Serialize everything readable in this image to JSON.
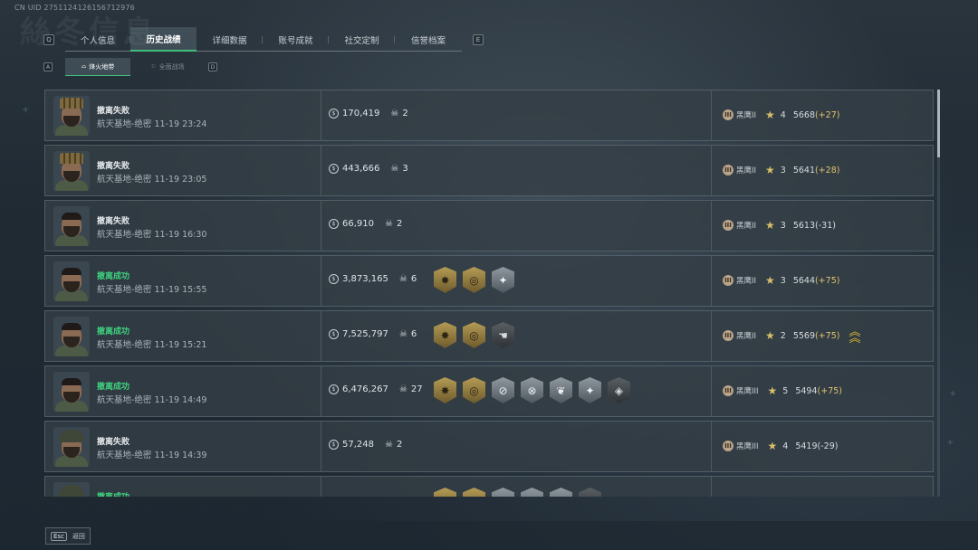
{
  "header": {
    "uid": "CN UID 2751124126156712976",
    "bg_title": "絲冬信息"
  },
  "tabs": {
    "key_prev": "Q",
    "key_next": "E",
    "items": [
      {
        "label": "个人信息",
        "active": false
      },
      {
        "label": "历史战绩",
        "active": true
      },
      {
        "label": "详细数据",
        "active": false
      },
      {
        "label": "账号成就",
        "active": false
      },
      {
        "label": "社交定制",
        "active": false
      },
      {
        "label": "信誉档案",
        "active": false
      }
    ]
  },
  "subtabs": {
    "key_prev": "A",
    "key_next": "D",
    "active_label": "烽火地带",
    "inactive_label": "全面战场"
  },
  "records": [
    {
      "result": "撤离失败",
      "success": false,
      "map": "航天基地-绝密 11-19 23:24",
      "value": "170,419",
      "kills": "2",
      "badges": [],
      "rank": "黑鹰II",
      "stars": "4",
      "score": "5668",
      "delta": "(+27)",
      "promo": false,
      "avatar": "crown"
    },
    {
      "result": "撤离失败",
      "success": false,
      "map": "航天基地-绝密 11-19 23:05",
      "value": "443,666",
      "kills": "3",
      "badges": [],
      "rank": "黑鹰II",
      "stars": "3",
      "score": "5641",
      "delta": "(+28)",
      "promo": false,
      "avatar": "crown"
    },
    {
      "result": "撤离失败",
      "success": false,
      "map": "航天基地-绝密 11-19 16:30",
      "value": "66,910",
      "kills": "2",
      "badges": [],
      "rank": "黑鹰II",
      "stars": "3",
      "score": "5613",
      "delta": "(-31)",
      "promo": false,
      "avatar": "bearded"
    },
    {
      "result": "撤离成功",
      "success": true,
      "map": "航天基地-绝密 11-19 15:55",
      "value": "3,873,165",
      "kills": "6",
      "badges": [
        "gold-sun",
        "gold-target",
        "silver-star"
      ],
      "rank": "黑鹰II",
      "stars": "3",
      "score": "5644",
      "delta": "(+75)",
      "promo": false,
      "avatar": "bearded"
    },
    {
      "result": "撤离成功",
      "success": true,
      "map": "航天基地-绝密 11-19 15:21",
      "value": "7,525,797",
      "kills": "6",
      "badges": [
        "gold-sun",
        "gold-target",
        "dark-hand"
      ],
      "rank": "黑鹰II",
      "stars": "2",
      "score": "5569",
      "delta": "(+75)",
      "promo": true,
      "avatar": "bearded"
    },
    {
      "result": "撤离成功",
      "success": true,
      "map": "航天基地-绝密 11-19 14:49",
      "value": "6,476,267",
      "kills": "27",
      "badges": [
        "gold-sun",
        "gold-target",
        "silver-scope",
        "silver-scope2",
        "silver-wings",
        "silver-star",
        "dark-diamond"
      ],
      "rank": "黑鹰III",
      "stars": "5",
      "score": "5494",
      "delta": "(+75)",
      "promo": false,
      "avatar": "bearded"
    },
    {
      "result": "撤离失败",
      "success": false,
      "map": "航天基地-绝密 11-19 14:39",
      "value": "57,248",
      "kills": "2",
      "badges": [],
      "rank": "黑鹰III",
      "stars": "4",
      "score": "5419",
      "delta": "(-29)",
      "promo": false,
      "avatar": "helmet"
    },
    {
      "result": "撤离成功",
      "success": true,
      "map": "",
      "value": "",
      "kills": "",
      "badges": [
        "gold-target",
        "gold-target",
        "silver-scope",
        "silver-scope2",
        "silver-star",
        "dark-diamond"
      ],
      "rank": "",
      "stars": "",
      "score": "",
      "delta": "",
      "promo": false,
      "avatar": "helmet"
    }
  ],
  "footer": {
    "esc_key": "Esc",
    "back_label": "返回"
  },
  "colors": {
    "accent_green": "#3fd27f",
    "gold": "#e2c46e"
  }
}
